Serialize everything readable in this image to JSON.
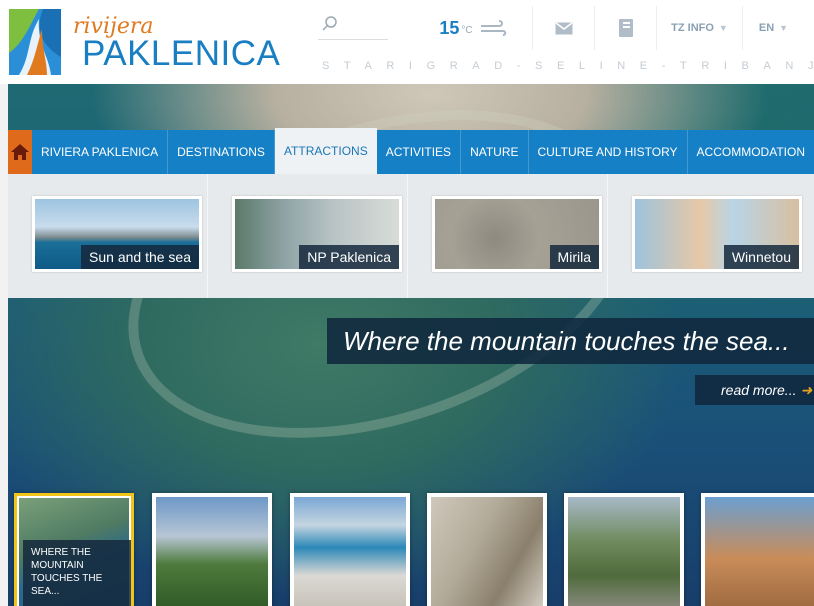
{
  "header": {
    "logo_script": "rivijera",
    "logo_main": "PAKLENICA",
    "search_icon": "search-icon",
    "temperature": "15",
    "temperature_unit": "°C",
    "weather_icon": "wind-icon",
    "mail_icon": "mail-icon",
    "book_icon": "book-icon",
    "tz_info": "TZ INFO",
    "language": "EN",
    "tagline": "STARIGRAD-SELINE-TRIBANJ"
  },
  "nav": {
    "home_icon": "home-icon",
    "items": [
      {
        "label": "RIVIERA PAKLENICA"
      },
      {
        "label": "DESTINATIONS"
      },
      {
        "label": "ATTRACTIONS"
      },
      {
        "label": "ACTIVITIES"
      },
      {
        "label": "NATURE"
      },
      {
        "label": "CULTURE AND HISTORY"
      },
      {
        "label": "ACCOMMODATION"
      }
    ]
  },
  "dropdown": {
    "items": [
      {
        "label": "Sun and the sea"
      },
      {
        "label": "NP Paklenica"
      },
      {
        "label": "Mirila"
      },
      {
        "label": "Winnetou"
      }
    ]
  },
  "hero": {
    "slogan": "Where the mountain touches the sea...",
    "read_more": "read more..."
  },
  "thumbs": {
    "active_caption": "WHERE THE MOUNTAIN TOUCHES THE SEA..."
  },
  "colors": {
    "brand_blue": "#1680c6",
    "accent_orange": "#e06a1c",
    "highlight_yellow": "#f0c419"
  }
}
